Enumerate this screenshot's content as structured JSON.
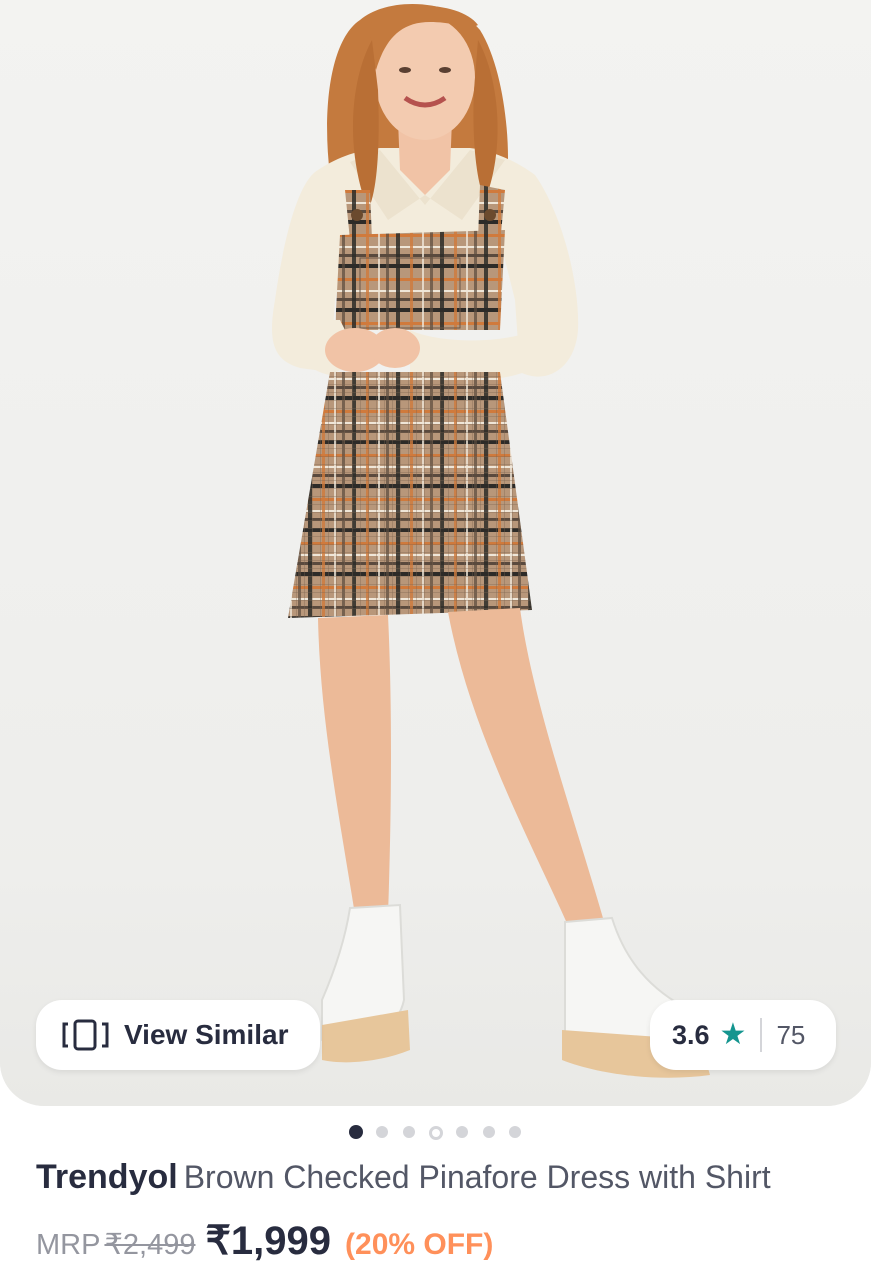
{
  "product_image": {
    "alt": "",
    "view_similar_label": "View Similar",
    "rating_value": "3.6",
    "rating_star": "★",
    "rating_count": "75",
    "carousel_dot_count": 7,
    "carousel_active_index": 0
  },
  "product": {
    "brand": "Trendyol",
    "name": "Brown Checked Pinafore Dress with Shirt"
  },
  "price": {
    "mrp_label": "MRP",
    "mrp_value": "₹2,499",
    "sale_price": "₹1,999",
    "discount": "(20% OFF)"
  },
  "colors": {
    "text_primary": "#282c3f",
    "text_secondary": "#535766",
    "text_muted": "#94969f",
    "rating_star": "#14958f",
    "discount": "#ff905a"
  },
  "icons": {
    "view_similar": "view-similar-icon",
    "rating": "star-icon"
  }
}
